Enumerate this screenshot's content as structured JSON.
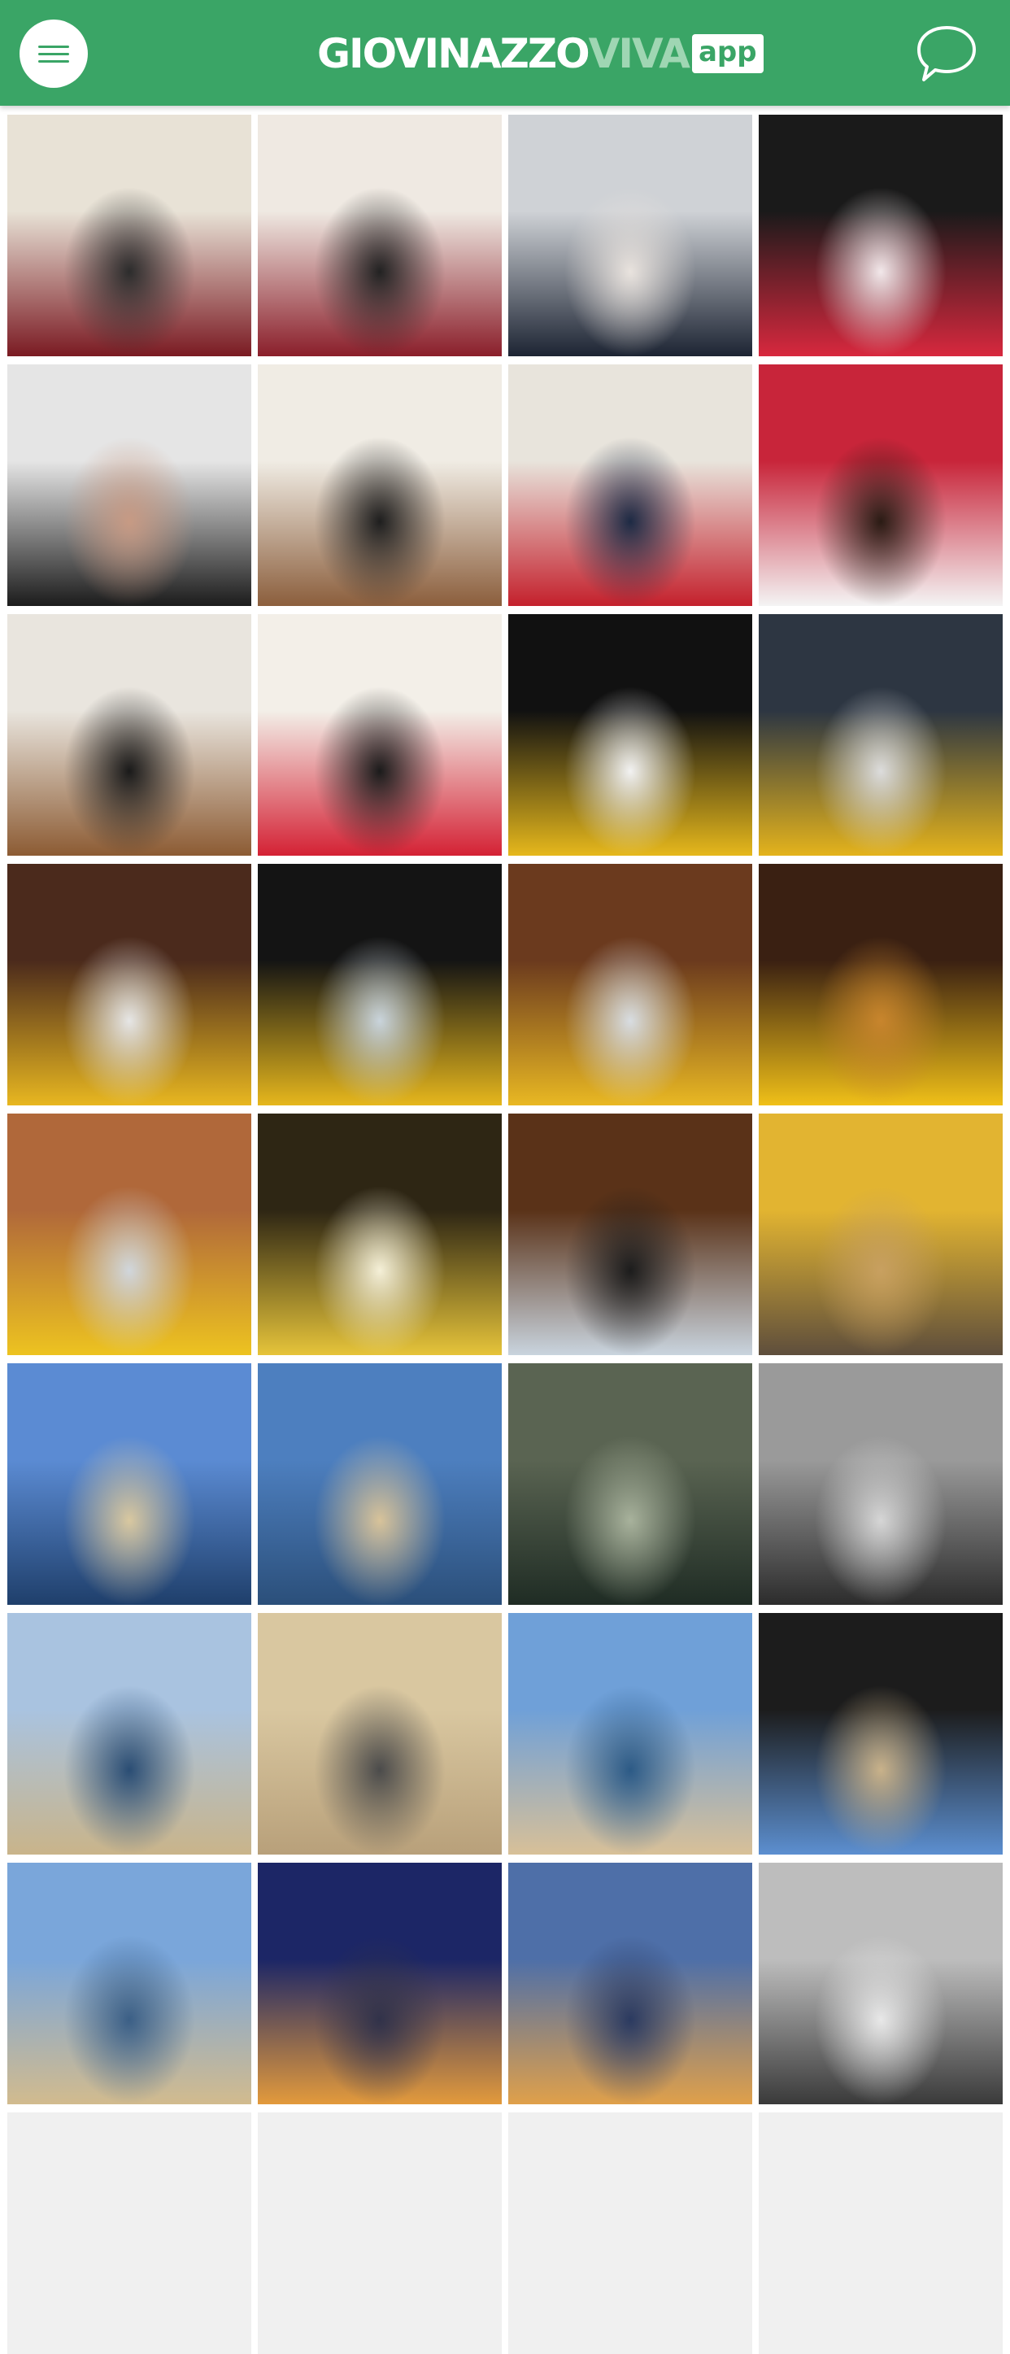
{
  "header": {
    "logo_main": "GIOVINAZZO",
    "logo_accent": "VIVA",
    "logo_badge": "app",
    "menu_icon": "hamburger-menu-icon",
    "chat_icon": "speech-bubble-icon",
    "color": "#3aa566"
  },
  "gallery": {
    "photos": [
      {
        "subject": "event-meeting-hall",
        "colors": [
          "#e8e2d6",
          "#7a1a22",
          "#2c2c2c"
        ]
      },
      {
        "subject": "event-stage-panel",
        "colors": [
          "#efe9e2",
          "#8a1e2a",
          "#222222"
        ]
      },
      {
        "subject": "speaker-microphone",
        "colors": [
          "#cfd2d6",
          "#1d2433",
          "#e9e3de"
        ]
      },
      {
        "subject": "presentation-table",
        "colors": [
          "#1a1a1a",
          "#d8283e",
          "#f2e8ea"
        ]
      },
      {
        "subject": "speaker-portrait",
        "colors": [
          "#e5e5e5",
          "#1c1c1c",
          "#c79a84"
        ]
      },
      {
        "subject": "panel-discussion",
        "colors": [
          "#f0ece4",
          "#8b5e3c",
          "#1e1e1e"
        ]
      },
      {
        "subject": "panel-table",
        "colors": [
          "#e8e4dc",
          "#c4202c",
          "#1d2a44"
        ]
      },
      {
        "subject": "pink-dress-tshirt",
        "colors": [
          "#c8253a",
          "#f4f4f4",
          "#2a1b14"
        ]
      },
      {
        "subject": "two-speakers",
        "colors": [
          "#e9e5de",
          "#8c5b33",
          "#1a1a1a"
        ]
      },
      {
        "subject": "three-speakers",
        "colors": [
          "#f3efe8",
          "#d42134",
          "#1b1b1b"
        ]
      },
      {
        "subject": "procession-canopy",
        "colors": [
          "#111111",
          "#e6b81c",
          "#f2f2f2"
        ]
      },
      {
        "subject": "procession-smoke",
        "colors": [
          "#2d3642",
          "#e4b31c",
          "#dcdcdc"
        ]
      },
      {
        "subject": "procession-street",
        "colors": [
          "#4b2a1c",
          "#e8b720",
          "#e6e6e6"
        ]
      },
      {
        "subject": "procession-night",
        "colors": [
          "#141414",
          "#e6b71d",
          "#c9d4dc"
        ]
      },
      {
        "subject": "procession-church-door",
        "colors": [
          "#6b3a1e",
          "#e9b823",
          "#d8dde2"
        ]
      },
      {
        "subject": "monstrance-closeup",
        "colors": [
          "#3a2012",
          "#f0c018",
          "#c8852d"
        ]
      },
      {
        "subject": "canopy-bearers",
        "colors": [
          "#b0683a",
          "#edc320",
          "#d0d6dc"
        ]
      },
      {
        "subject": "church-exit",
        "colors": [
          "#2e2614",
          "#e6c43a",
          "#f5f0d8"
        ]
      },
      {
        "subject": "church-interior",
        "colors": [
          "#5a3218",
          "#c9d4de",
          "#1c1c1c"
        ]
      },
      {
        "subject": "parish-banner",
        "colors": [
          "#e2b431",
          "#5e4e3c",
          "#c8a060"
        ]
      },
      {
        "subject": "harbour-boats",
        "colors": [
          "#5b8bd3",
          "#1f3f6b",
          "#d9c8a0"
        ]
      },
      {
        "subject": "cathedral-waterfront",
        "colors": [
          "#4d7fbf",
          "#2b4f7a",
          "#d8c39a"
        ]
      },
      {
        "subject": "harbour-greenish",
        "colors": [
          "#5a6452",
          "#1f2c24",
          "#a8b29c"
        ]
      },
      {
        "subject": "sea-bw",
        "colors": [
          "#9a9a9a",
          "#2c2c2c",
          "#d6d6d6"
        ]
      },
      {
        "subject": "old-town-marina",
        "colors": [
          "#a9c3e0",
          "#c9b48a",
          "#2a4d74"
        ]
      },
      {
        "subject": "street-shrine",
        "colors": [
          "#d9c7a0",
          "#b8a07a",
          "#4b4b4b"
        ]
      },
      {
        "subject": "rowing-harbour",
        "colors": [
          "#6fa0d8",
          "#d8c098",
          "#2c5a86"
        ]
      },
      {
        "subject": "archway-view",
        "colors": [
          "#1c1c1c",
          "#5c8fd0",
          "#c9b28a"
        ]
      },
      {
        "subject": "stone-walls-boats",
        "colors": [
          "#7aa6da",
          "#d2bb8e",
          "#3b5f86"
        ]
      },
      {
        "subject": "town-night-lights",
        "colors": [
          "#1c2666",
          "#e39a3c",
          "#31324a"
        ]
      },
      {
        "subject": "cathedral-dusk",
        "colors": [
          "#4e6fa8",
          "#e0a04a",
          "#2b3a60"
        ]
      },
      {
        "subject": "tower-bw",
        "colors": [
          "#bdbdbd",
          "#3a3a3a",
          "#e8e8e8"
        ]
      },
      {
        "subject": "placeholder",
        "colors": [
          "#f0f0f0",
          "#f0f0f0",
          "#f0f0f0"
        ]
      },
      {
        "subject": "placeholder",
        "colors": [
          "#f0f0f0",
          "#f0f0f0",
          "#f0f0f0"
        ]
      },
      {
        "subject": "placeholder",
        "colors": [
          "#f0f0f0",
          "#f0f0f0",
          "#f0f0f0"
        ]
      },
      {
        "subject": "placeholder",
        "colors": [
          "#f0f0f0",
          "#f0f0f0",
          "#f0f0f0"
        ]
      }
    ]
  }
}
